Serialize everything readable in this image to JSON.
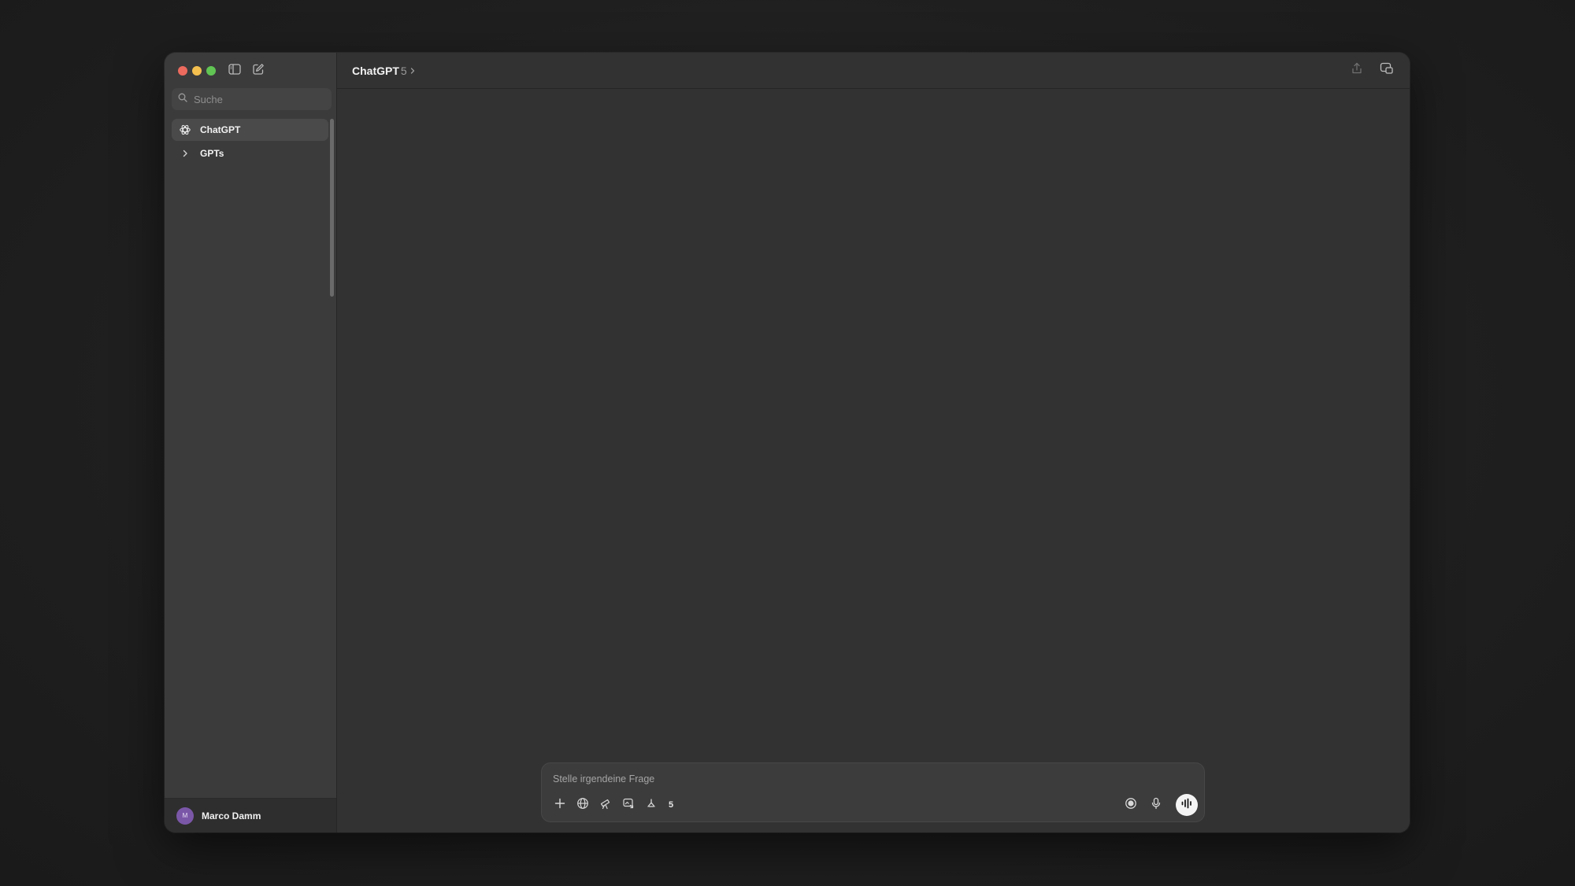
{
  "window": {
    "traffic_lights": {
      "close": "#ec6a5e",
      "minimize": "#f4bf4f",
      "maximize": "#61c554"
    }
  },
  "sidebar": {
    "toggle_icon": "sidebar-icon",
    "new_chat_icon": "compose-icon",
    "search": {
      "placeholder": "Suche",
      "value": "",
      "icon": "search-icon"
    },
    "items": [
      {
        "label": "ChatGPT",
        "icon": "openai-logo-icon",
        "active": true
      },
      {
        "label": "GPTs",
        "icon": "chevron-right-icon",
        "active": false
      }
    ],
    "user": {
      "name": "Marco Damm",
      "avatar_initial": "M",
      "avatar_color": "#7b57a8"
    }
  },
  "header": {
    "model_name": "ChatGPT",
    "model_version": "5",
    "chevron_icon": "chevron-right-icon",
    "share_icon": "share-icon",
    "new_window_icon": "new-window-icon"
  },
  "composer": {
    "placeholder": "Stelle irgendeine Frage",
    "value": "",
    "tools": [
      "plus-icon",
      "globe-icon",
      "telescope-icon",
      "image-icon",
      "apps-icon"
    ],
    "tool_count": "5",
    "right_icons": [
      "record-icon",
      "microphone-icon",
      "voice-mode-icon"
    ]
  }
}
